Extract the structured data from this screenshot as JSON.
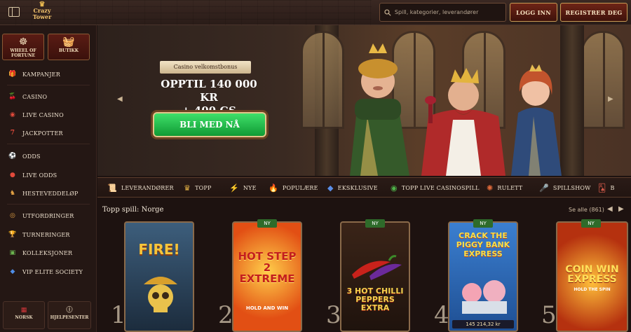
{
  "header": {
    "logo_line1": "Crazy",
    "logo_line2": "Tower",
    "search_placeholder": "Spill, kategorier, leverandører",
    "login_label": "LOGG INN",
    "register_label": "REGISTRER DEG"
  },
  "sidebar": {
    "tiles": [
      {
        "label": "WHEEL OF FORTUNE",
        "icon": "wheel-icon"
      },
      {
        "label": "BUTIKK",
        "icon": "basket-icon"
      }
    ],
    "items": [
      {
        "label": "KAMPANJER",
        "icon": "gift-icon"
      },
      {
        "label": "CASINO",
        "icon": "cherries-icon"
      },
      {
        "label": "LIVE CASINO",
        "icon": "chip-icon"
      },
      {
        "label": "JACKPOTTER",
        "icon": "seven-icon"
      },
      {
        "label": "ODDS",
        "icon": "football-icon"
      },
      {
        "label": "LIVE ODDS",
        "icon": "live-icon"
      },
      {
        "label": "HESTEVEDDELØP",
        "icon": "horse-icon"
      },
      {
        "label": "UTFORDRINGER",
        "icon": "coin-icon"
      },
      {
        "label": "TURNERINGER",
        "icon": "trophy-icon"
      },
      {
        "label": "KOLLEKSJONER",
        "icon": "cards-icon"
      },
      {
        "label": "VIP ELITE SOCIETY",
        "icon": "diamond-icon"
      }
    ],
    "footer": [
      {
        "label": "NORSK",
        "icon": "flag-icon"
      },
      {
        "label": "HJELPESENTER",
        "icon": "help-icon"
      }
    ]
  },
  "hero": {
    "bonus_label": "Casino velkomstbonus",
    "amount_line1": "OPPTIL 140 000 KR",
    "amount_line2": "+ 400 GS",
    "cta_label": "BLI MED NÅ"
  },
  "categories": [
    {
      "label": "LEVERANDØRER",
      "icon": "scroll-icon"
    },
    {
      "label": "TOPP",
      "icon": "crown-icon"
    },
    {
      "label": "NYE",
      "icon": "lightning-icon"
    },
    {
      "label": "POPULÆRE",
      "icon": "fire-icon"
    },
    {
      "label": "EKSKLUSIVE",
      "icon": "gem-icon"
    },
    {
      "label": "TOPP LIVE CASINOSPILL",
      "icon": "chip-icon"
    },
    {
      "label": "RULETT",
      "icon": "roulette-icon"
    },
    {
      "label": "SPILLSHOW",
      "icon": "mic-icon"
    },
    {
      "label": "B",
      "icon": "cards-icon"
    }
  ],
  "top_games": {
    "title": "Topp spill: Norge",
    "see_all": "Se alle (861)",
    "new_badge": "NY",
    "games": [
      {
        "rank": "1",
        "title": "FIRE!",
        "is_new": false,
        "jackpot": ""
      },
      {
        "rank": "2",
        "title": "HOT STEP 2 EXTREME",
        "subtitle": "HOLD AND WIN",
        "is_new": true,
        "jackpot": ""
      },
      {
        "rank": "3",
        "title": "3 HOT CHILLI PEPPERS EXTRA",
        "is_new": true,
        "jackpot": ""
      },
      {
        "rank": "4",
        "title": "CRACK THE PIGGY BANK EXPRESS",
        "is_new": true,
        "jackpot": "145 214,32 kr"
      },
      {
        "rank": "5",
        "title": "COIN WIN EXPRESS",
        "subtitle": "HOLD THE SPIN",
        "is_new": true,
        "jackpot": ""
      }
    ]
  },
  "colors": {
    "background": "#1d1210",
    "gold_border": "#c99c55",
    "cta_green": "#1fb949",
    "burgundy": "#5a1c14"
  }
}
